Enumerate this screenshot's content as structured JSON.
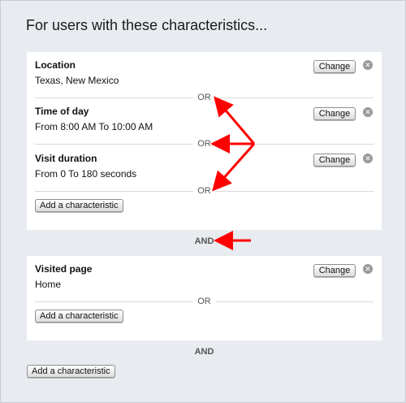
{
  "heading": "For users with these characteristics...",
  "groups": [
    {
      "characteristics": [
        {
          "name": "Location",
          "value": "Texas, New Mexico",
          "change_label": "Change"
        },
        {
          "name": "Time of day",
          "value": "From 8:00 AM To 10:00 AM",
          "change_label": "Change"
        },
        {
          "name": "Visit duration",
          "value": "From 0 To 180 seconds",
          "change_label": "Change"
        }
      ],
      "or_labels": [
        "OR",
        "OR",
        "OR"
      ],
      "add_label": "Add a characteristic"
    },
    {
      "characteristics": [
        {
          "name": "Visited page",
          "value": "Home",
          "change_label": "Change"
        }
      ],
      "or_labels": [
        "OR"
      ],
      "add_label": "Add a characteristic"
    }
  ],
  "and_labels": [
    "AND",
    "AND"
  ],
  "add_group_label": "Add a characteristic",
  "colors": {
    "annotation_arrow": "#ff0000",
    "panel_bg": "#e8ebef"
  },
  "icons": {
    "remove": "close-icon"
  }
}
